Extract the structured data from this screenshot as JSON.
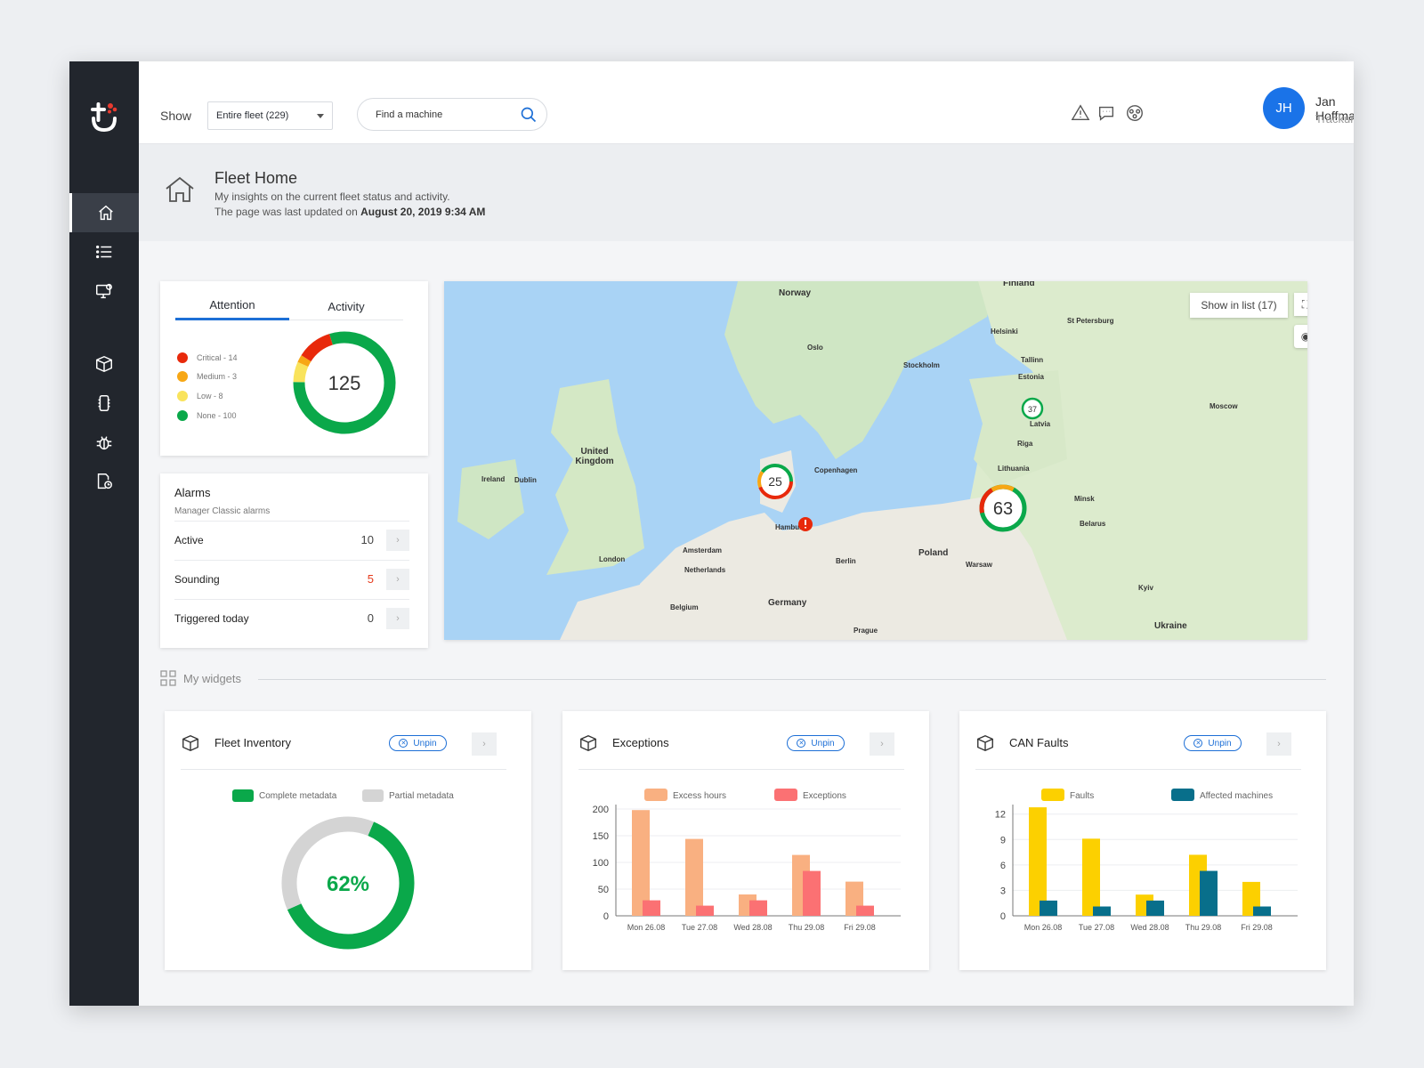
{
  "header": {
    "show_label": "Show",
    "fleet_select": "Entire fleet (229)",
    "search_placeholder": "Find a machine",
    "user": {
      "initials": "JH",
      "name": "Jan Hoffman",
      "org": "Trackunit"
    }
  },
  "page": {
    "title": "Fleet Home",
    "subtitle": "My insights on the current fleet status and activity.",
    "updated_prefix": "The page was last updated on",
    "updated_date": "August 20, 2019 9:34 AM"
  },
  "attention": {
    "tabs": [
      "Attention",
      "Activity"
    ],
    "total": "125",
    "legend": [
      {
        "label": "Critical - 14",
        "color": "#e8290b"
      },
      {
        "label": "Medium - 3",
        "color": "#f7a715"
      },
      {
        "label": "Low - 8",
        "color": "#f9e35c"
      },
      {
        "label": "None - 100",
        "color": "#0aa84a"
      }
    ]
  },
  "alarms": {
    "title": "Alarms",
    "subtitle": "Manager Classic alarms",
    "rows": [
      {
        "label": "Active",
        "value": "10"
      },
      {
        "label": "Sounding",
        "value": "5"
      },
      {
        "label": "Triggered today",
        "value": "0"
      }
    ]
  },
  "map": {
    "show_in_list": "Show in list (17)",
    "clusters": [
      "25",
      "63",
      "37"
    ],
    "places": [
      "Norway",
      "Finland",
      "United Kingdom",
      "Ireland",
      "Latvia",
      "Lithuania",
      "Estonia",
      "Poland",
      "Germany",
      "Netherlands",
      "Belgium",
      "Belarus",
      "Ukraine",
      "Stockholm",
      "Oslo",
      "Hamburg",
      "Berlin",
      "Warsaw",
      "Minsk",
      "Moscow",
      "Riga",
      "Copenhagen",
      "Dublin",
      "London",
      "Amsterdam",
      "Helsinki",
      "St Petersburg",
      "Tallinn",
      "Kyiv",
      "Prague"
    ]
  },
  "widgets": {
    "header": "My widgets",
    "unpin_label": "Unpin",
    "inventory": {
      "title": "Fleet Inventory",
      "legend": [
        "Complete metadata",
        "Partial metadata"
      ],
      "percent_label": "62%"
    },
    "exceptions": {
      "title": "Exceptions"
    },
    "can_faults": {
      "title": "CAN Faults"
    }
  },
  "colors": {
    "accent": "#1d6fd6",
    "excess": "#f9b081",
    "exceptions": "#fb7173",
    "faults": "#fcd000",
    "affected": "#086f8b",
    "complete": "#0aa84a",
    "partial": "#d4d4d4"
  },
  "chart_data": [
    {
      "type": "pie",
      "title": "Attention",
      "categories": [
        "Critical",
        "Medium",
        "Low",
        "None"
      ],
      "values": [
        14,
        3,
        8,
        100
      ]
    },
    {
      "type": "pie",
      "title": "Fleet Inventory",
      "categories": [
        "Complete metadata",
        "Partial metadata"
      ],
      "values": [
        62,
        38
      ]
    },
    {
      "type": "bar",
      "title": "Exceptions",
      "categories": [
        "Mon 26.08",
        "Tue 27.08",
        "Wed 28.08",
        "Thu 29.08",
        "Fri 29.08"
      ],
      "series": [
        {
          "name": "Excess hours",
          "values": [
            198,
            144,
            40,
            114,
            64
          ]
        },
        {
          "name": "Exceptions",
          "values": [
            29,
            19,
            29,
            84,
            19
          ]
        }
      ],
      "yticks": [
        0,
        50,
        100,
        150,
        200
      ],
      "ylim": [
        0,
        200
      ]
    },
    {
      "type": "bar",
      "title": "CAN Faults",
      "categories": [
        "Mon 26.08",
        "Tue 27.08",
        "Wed 28.08",
        "Thu 29.08",
        "Fri 29.08"
      ],
      "series": [
        {
          "name": "Faults",
          "values": [
            12.8,
            9.1,
            2.5,
            7.2,
            4
          ]
        },
        {
          "name": "Affected machines",
          "values": [
            1.8,
            1.1,
            1.8,
            5.3,
            1.1
          ]
        }
      ],
      "yticks": [
        0,
        3,
        6,
        9,
        12
      ],
      "ylim": [
        0,
        12.6
      ]
    }
  ]
}
